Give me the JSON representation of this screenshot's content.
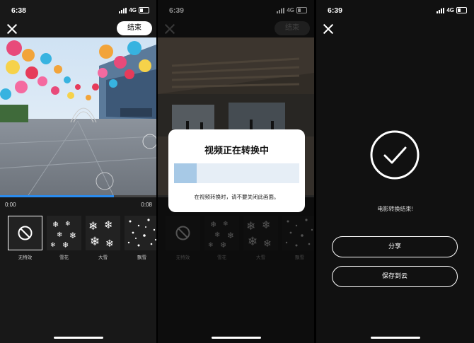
{
  "screens": [
    {
      "status": {
        "time": "6:38",
        "network": "4G"
      },
      "done_label": "结束",
      "time_start": "0:00",
      "time_end": "0:08",
      "progress": 0.73,
      "effects": [
        {
          "label": "无特效",
          "icon": "no-effect-icon",
          "selected": true
        },
        {
          "label": "雪花",
          "icon": "snowflake-icon"
        },
        {
          "label": "大雪",
          "icon": "heavy-snow-icon"
        },
        {
          "label": "飘雪",
          "icon": "falling-snow-icon"
        }
      ]
    },
    {
      "status": {
        "time": "6:39",
        "network": "4G"
      },
      "done_label": "结束",
      "modal": {
        "title": "视频正在转换中",
        "progress": 0.18,
        "message": "在视频转换时，请不要关闭此画面。"
      },
      "effects": [
        {
          "label": "无特效",
          "icon": "no-effect-icon"
        },
        {
          "label": "雪花",
          "icon": "snowflake-icon"
        },
        {
          "label": "大雪",
          "icon": "heavy-snow-icon"
        },
        {
          "label": "飘雪",
          "icon": "falling-snow-icon"
        }
      ]
    },
    {
      "status": {
        "time": "6:39",
        "network": "4G"
      },
      "finish_text": "电影转换结束!",
      "share_label": "分享",
      "save_label": "保存到云"
    }
  ],
  "colors": {
    "accent": "#2a8cf0",
    "modal_bar": "#a7c9e6"
  }
}
